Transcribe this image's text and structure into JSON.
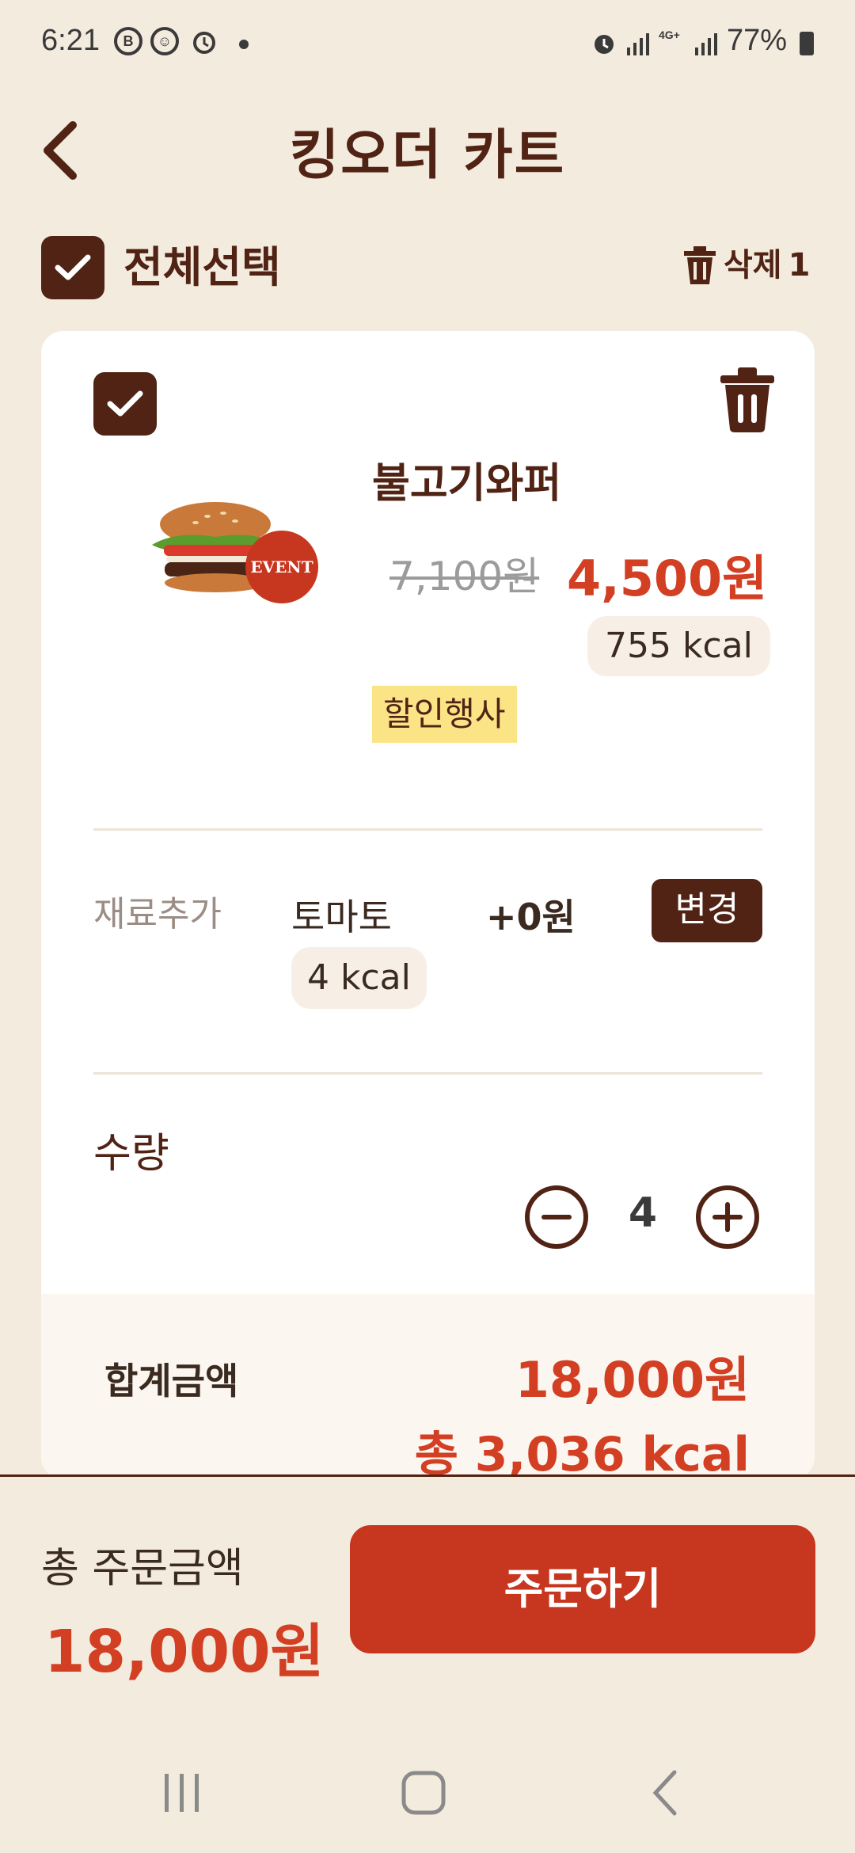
{
  "status_bar": {
    "time": "6:21",
    "icons": [
      "b-badge-icon",
      "face-icon",
      "alarm-icon"
    ],
    "battery": "77%",
    "network": "4G+"
  },
  "header": {
    "title": "킹오더 카트",
    "back_icon": "chevron-left-icon"
  },
  "toolbar": {
    "select_all_label": "전체선택",
    "delete_label": "삭제",
    "delete_count": "1"
  },
  "item": {
    "name": "불고기와퍼",
    "badge": "EVENT",
    "original_price": "7,100원",
    "sale_price": "4,500원",
    "kcal": "755 kcal",
    "tag": "할인행사",
    "option": {
      "label": "재료추가",
      "name": "토마토",
      "price": "+0원",
      "kcal": "4 kcal",
      "change_label": "변경"
    },
    "quantity": {
      "label": "수량",
      "value": "4"
    },
    "summary": {
      "label": "합계금액",
      "price": "18,000원",
      "kcal": "총 3,036 kcal"
    }
  },
  "footer": {
    "total_label": "총 주문금액",
    "total_price": "18,000원",
    "order_label": "주문하기"
  },
  "colors": {
    "brand_brown": "#502314",
    "accent_red": "#d23f23",
    "background": "#f4ebdf",
    "order_button": "#c7361f",
    "tag_yellow": "#fbe486"
  }
}
